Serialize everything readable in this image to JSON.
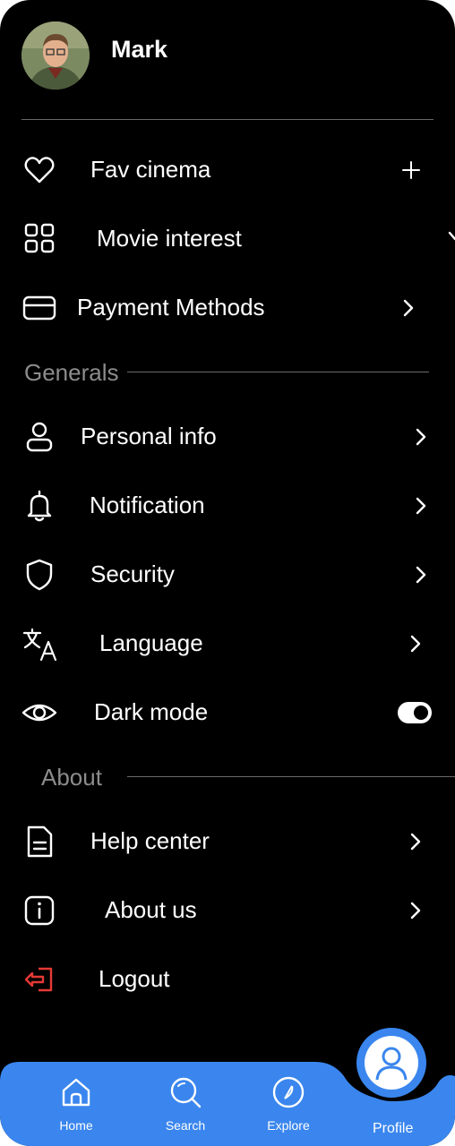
{
  "profile": {
    "name": "Mark"
  },
  "menu": {
    "fav_cinema": "Fav cinema",
    "movie_interest": "Movie interest",
    "payment_methods": "Payment Methods"
  },
  "generals": {
    "heading": "Generals",
    "personal_info": "Personal info",
    "notification": "Notification",
    "security": "Security",
    "language": "Language",
    "dark_mode": "Dark mode",
    "dark_mode_on": true
  },
  "about": {
    "heading": "About",
    "help_center": "Help center",
    "about_us": "About us",
    "logout": "Logout"
  },
  "nav": {
    "home": "Home",
    "search": "Search",
    "explore": "Explore",
    "profile": "Profile",
    "active": "profile"
  },
  "colors": {
    "accent": "#3a86ee",
    "logout": "#e53935",
    "background": "#000000"
  }
}
